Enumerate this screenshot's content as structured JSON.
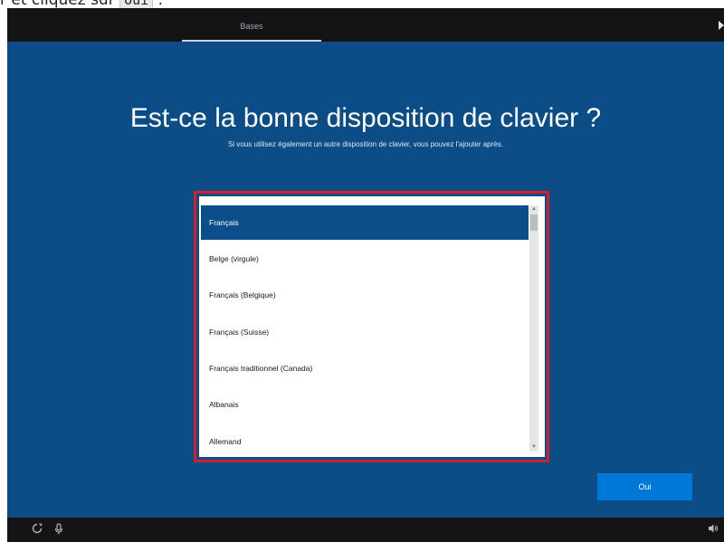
{
  "instruction": {
    "prefix": "r et cliquez sur ",
    "key": "Oui",
    "suffix": " ."
  },
  "topbar": {
    "tab_label": "Bases"
  },
  "main": {
    "title": "Est-ce la bonne disposition de clavier ?",
    "subtitle": "Si vous utilisez également un autre disposition de clavier, vous pouvez l'ajouter après."
  },
  "keyboard_list": {
    "selected_index": 0,
    "items": [
      "Français",
      "Belge (virgule)",
      "Français (Belgique)",
      "Français (Suisse)",
      "Français traditionnel (Canada)",
      "Albanais",
      "Allemand"
    ]
  },
  "buttons": {
    "ok_label": "Oui"
  },
  "icons": {
    "accessibility": "accessibility-icon",
    "microphone": "microphone-icon",
    "volume": "volume-icon"
  },
  "colors": {
    "background": "#0c4d87",
    "highlight_frame": "#d21f2b",
    "selected_item": "#0c4e89",
    "button": "#0078d7"
  }
}
